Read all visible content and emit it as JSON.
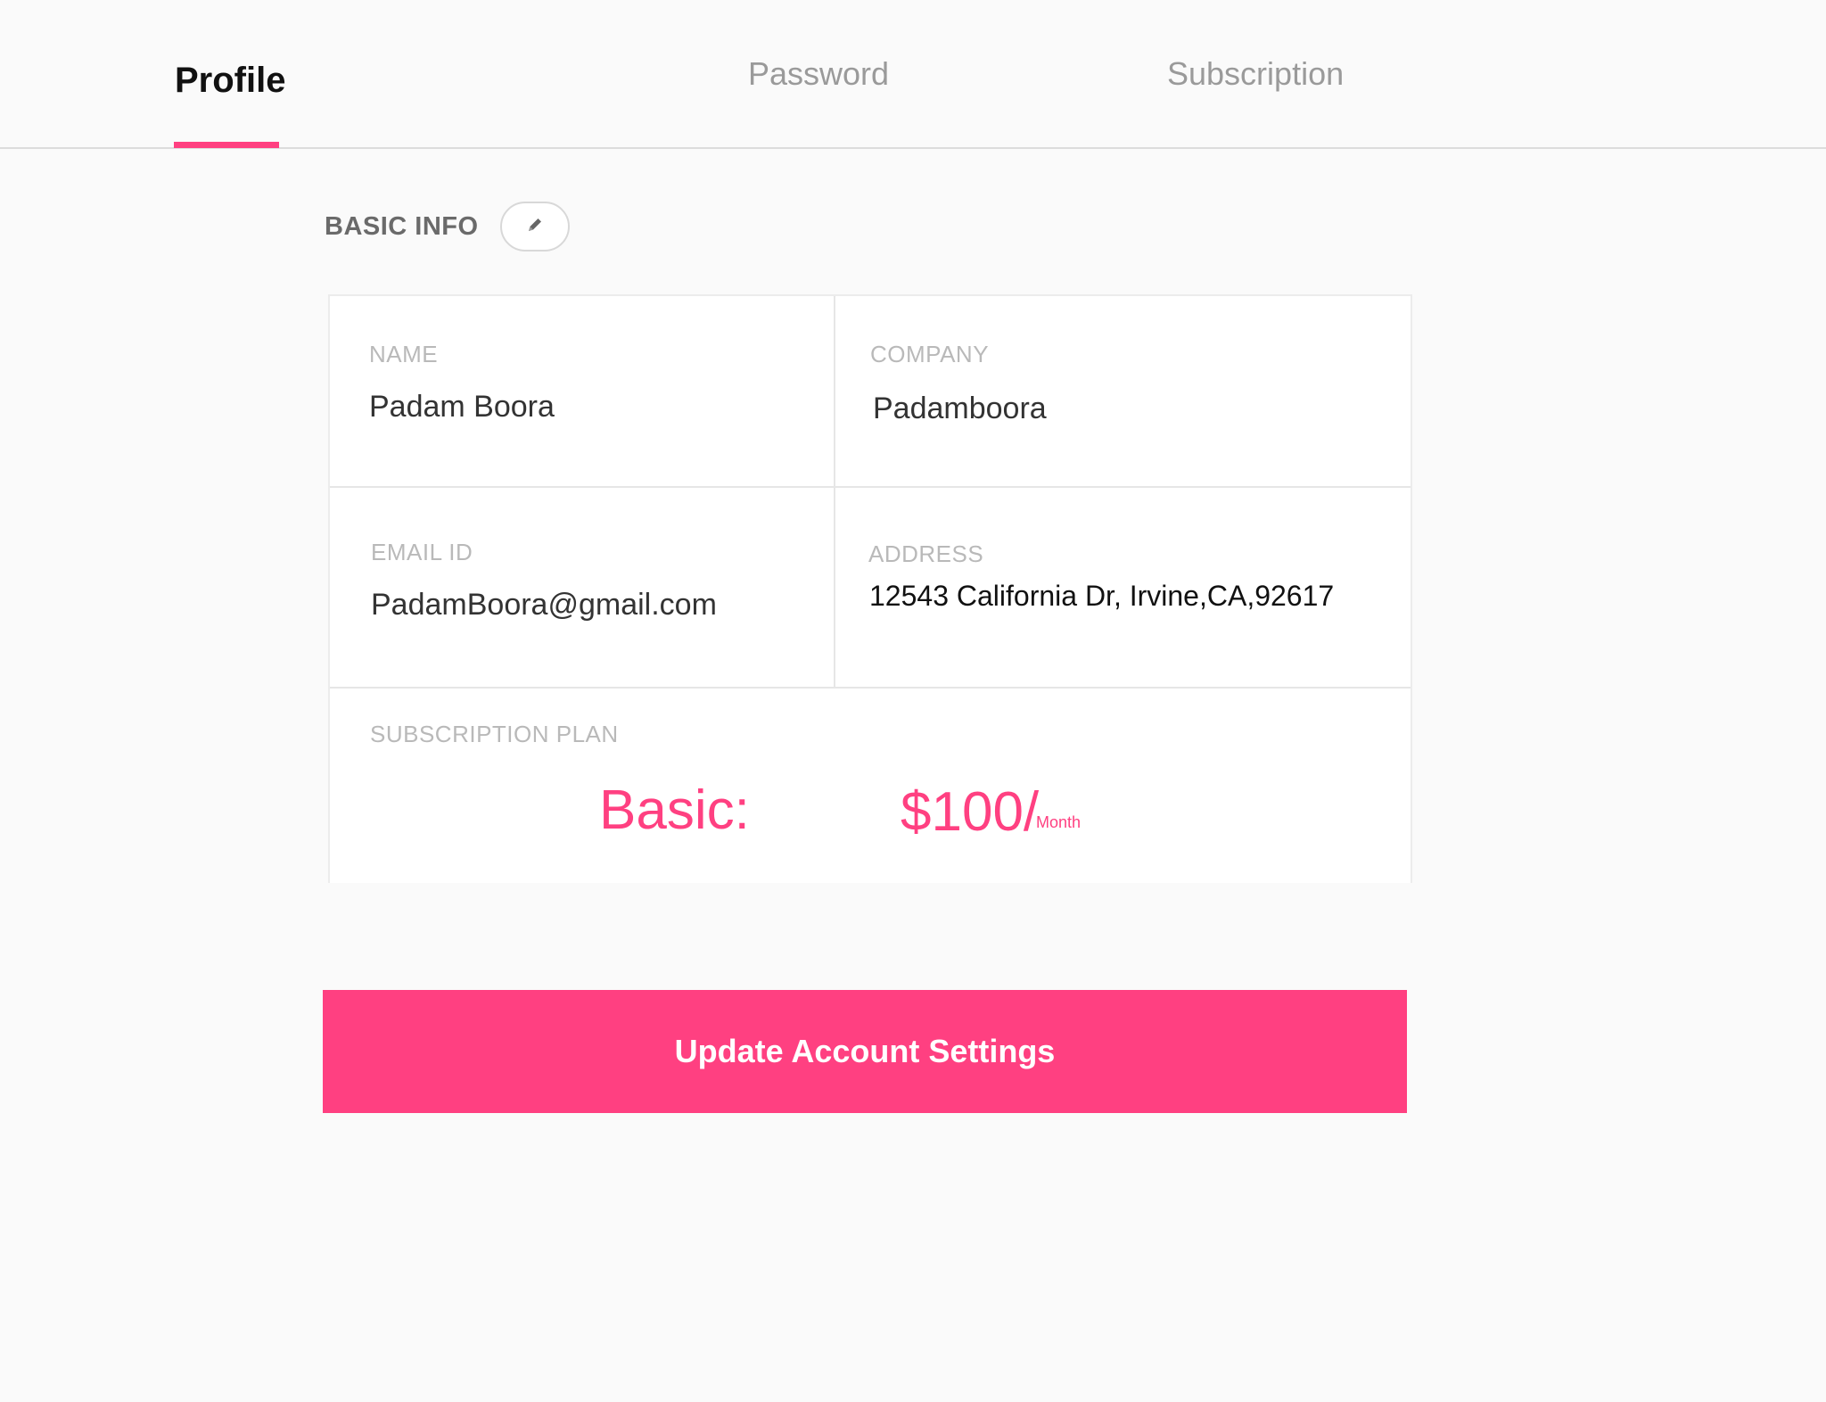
{
  "tabs": [
    {
      "label": "Profile",
      "active": true
    },
    {
      "label": "Password",
      "active": false
    },
    {
      "label": "Subscription",
      "active": false
    }
  ],
  "section": {
    "title": "BASIC INFO",
    "edit_icon": "pencil-icon"
  },
  "fields": {
    "name": {
      "label": "NAME",
      "value": "Padam Boora"
    },
    "company": {
      "label": "COMPANY",
      "value": "Padamboora"
    },
    "email": {
      "label": "EMAIL ID",
      "value": "PadamBoora@gmail.com"
    },
    "address": {
      "label": "ADDRESS",
      "value": "12543 California Dr, Irvine,CA,92617"
    }
  },
  "subscription": {
    "label": "SUBSCRIPTION PLAN",
    "plan": "Basic:",
    "price": "$100/",
    "period": "Month"
  },
  "update_button": {
    "label": "Update Account Settings"
  },
  "colors": {
    "accent": "#ff4081",
    "background": "#fafafa",
    "card": "#ffffff"
  }
}
